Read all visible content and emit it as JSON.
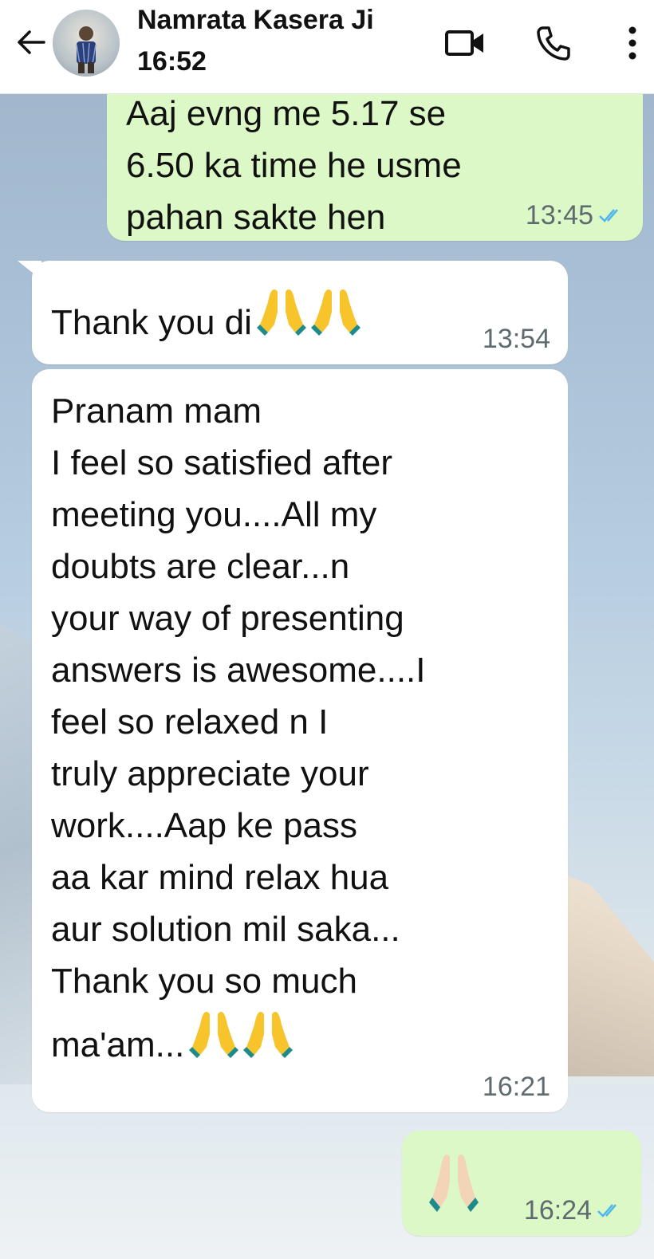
{
  "header": {
    "contact_name": "Namrata Kasera Ji",
    "status": "16:52",
    "icons": [
      "back-arrow-icon",
      "avatar",
      "video-call-icon",
      "phone-icon",
      "more-options-icon"
    ]
  },
  "messages": [
    {
      "direction": "outgoing",
      "text": "Aaj evng me 5.17 se\n6.50 ka time he usme\npahan sakte hen",
      "time": "13:45",
      "read": true
    },
    {
      "direction": "incoming",
      "text": "Thank you di",
      "emoji": [
        "folded-hands",
        "folded-hands"
      ],
      "time": "13:54"
    },
    {
      "direction": "incoming",
      "text": "Pranam mam\nI feel so satisfied after\nmeeting you....All my\ndoubts are clear...n\nyour way of presenting\nanswers is awesome....I\nfeel so relaxed n I\ntruly appreciate your\nwork....Aap ke pass\naa kar mind relax hua\naur solution mil saka...\nThank you so much\nma'am...",
      "emoji": [
        "folded-hands",
        "folded-hands"
      ],
      "time": "16:21"
    },
    {
      "direction": "outgoing",
      "text": "",
      "emoji": [
        "folded-hands-light"
      ],
      "time": "16:24",
      "read": true
    }
  ],
  "colors": {
    "outgoing_bubble": "#dcf8c6",
    "incoming_bubble": "#ffffff",
    "read_tick": "#4fb6ec",
    "header_bg": "#ffffff"
  }
}
